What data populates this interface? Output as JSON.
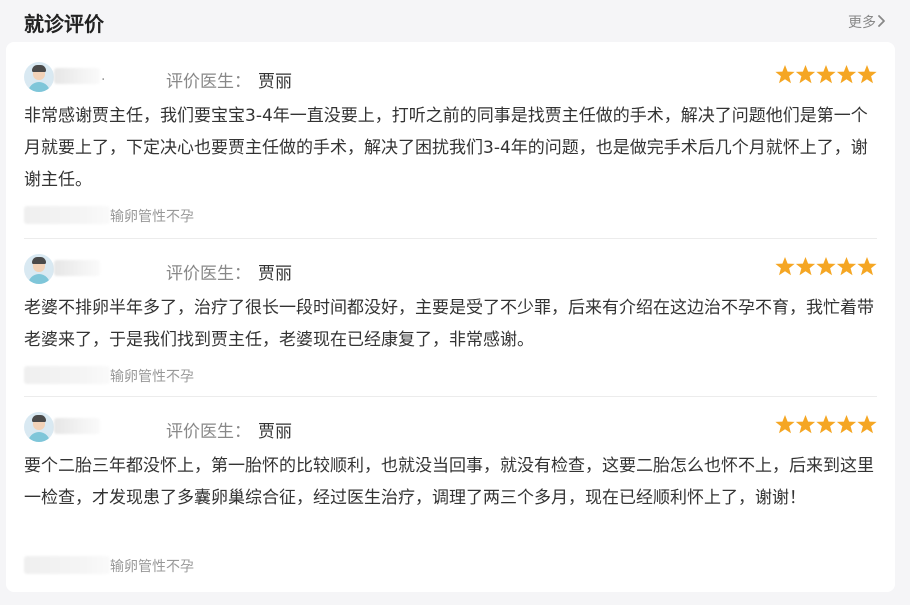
{
  "section": {
    "title": "就诊评价",
    "more_label": "更多"
  },
  "colors": {
    "star": "#f5a623",
    "accent_text": "#333333",
    "muted_text": "#888888"
  },
  "reviews": [
    {
      "doctor_label": "评价医生：",
      "doctor_name": "贾丽",
      "rating": 5,
      "content": "非常感谢贾主任，我们要宝宝3-4年一直没要上，打听之前的同事是找贾主任做的手术，解决了问题他们是第一个月就要上了，下定决心也要贾主任做的手术，解决了困扰我们3-4年的问题，也是做完手术后几个月就怀上了，谢谢主任。",
      "tag": "输卵管性不孕",
      "name_suffix": "."
    },
    {
      "doctor_label": "评价医生：",
      "doctor_name": "贾丽",
      "rating": 5,
      "content": "老婆不排卵半年多了，治疗了很长一段时间都没好，主要是受了不少罪，后来有介绍在这边治不孕不育，我忙着带老婆来了，于是我们找到贾主任，老婆现在已经康复了，非常感谢。",
      "tag": "输卵管性不孕",
      "name_suffix": ""
    },
    {
      "doctor_label": "评价医生：",
      "doctor_name": "贾丽",
      "rating": 5,
      "content": "要个二胎三年都没怀上，第一胎怀的比较顺利，也就没当回事，就没有检查，这要二胎怎么也怀不上，后来到这里一检查，才发现患了多囊卵巢综合征，经过医生治疗，调理了两三个多月，现在已经顺利怀上了，谢谢！",
      "tag": "输卵管性不孕",
      "name_suffix": ""
    }
  ]
}
